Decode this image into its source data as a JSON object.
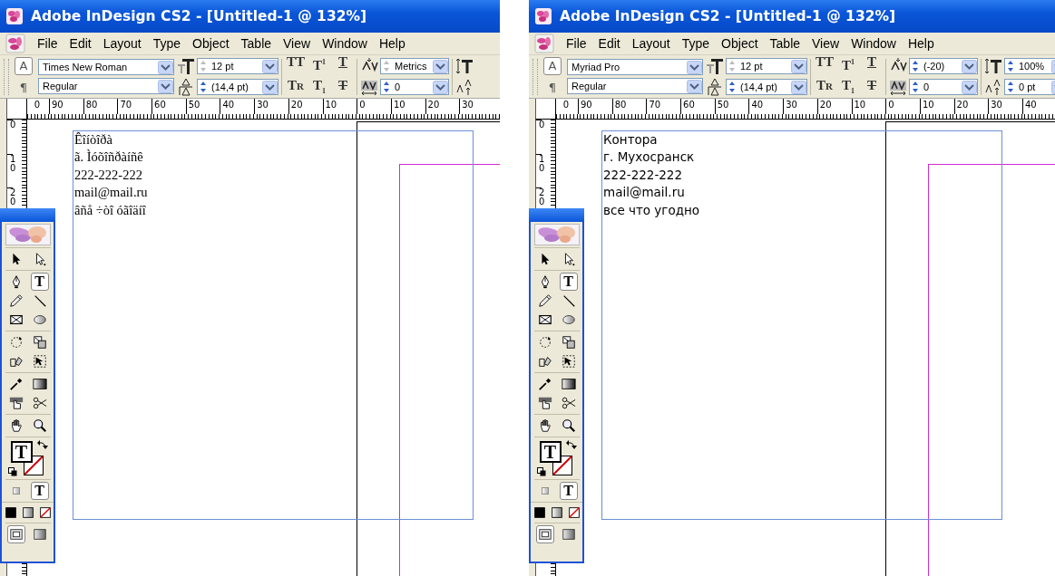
{
  "windows": [
    {
      "title": "Adobe InDesign CS2 - [Untitled-1 @ 132%]",
      "menu": [
        "File",
        "Edit",
        "Layout",
        "Type",
        "Object",
        "Table",
        "View",
        "Window",
        "Help"
      ],
      "control_bar": {
        "modes": [
          {
            "label": "A",
            "selected": true
          },
          {
            "label": "¶",
            "selected": false
          }
        ],
        "font": "Times New Roman",
        "style": "Regular",
        "size": {
          "value": "12 pt",
          "spinner_disabled": true
        },
        "leading": {
          "value": "(14,4 pt)",
          "spinner_disabled": false
        },
        "formats": [
          {
            "label": "TT",
            "kind": "all-caps"
          },
          {
            "label": "T$^{1}$",
            "kind": "superscript"
          },
          {
            "label": "T",
            "kind": "underline"
          },
          {
            "label": "Tr",
            "kind": "small-caps"
          },
          {
            "label": "T$_{1}$",
            "kind": "subscript"
          },
          {
            "label": "T",
            "kind": "strikethrough"
          }
        ],
        "kerning": {
          "value": "Metrics",
          "spinner_disabled": true
        },
        "tracking": {
          "value": "0",
          "spinner_disabled": false
        }
      },
      "ruler": {
        "horizontal": [
          "0",
          "90",
          "80",
          "70",
          "60",
          "50",
          "40",
          "30",
          "20",
          "10",
          "0",
          "10",
          "20",
          "30"
        ],
        "vertical": [
          "0",
          "10",
          "20"
        ]
      },
      "text_frame": {
        "kind": "serif",
        "lines": [
          "Êîíòîðà",
          "ã. Ìóõîñðàíñê",
          "222-222-222",
          "mail@mail.ru",
          "âñå ÷òî óãîäíî"
        ]
      },
      "toolbox": {
        "groups": [
          [
            {
              "kind": "selection",
              "selected": false
            },
            {
              "kind": "direct-selection",
              "selected": false
            }
          ],
          [
            {
              "kind": "pen",
              "selected": false
            },
            {
              "kind": "type",
              "label": "T",
              "selected": true
            },
            {
              "kind": "pencil",
              "selected": false
            },
            {
              "kind": "line",
              "selected": false
            },
            {
              "kind": "frame",
              "selected": false
            },
            {
              "kind": "ellipse",
              "selected": false
            }
          ],
          [
            {
              "kind": "rotate",
              "selected": false
            },
            {
              "kind": "scale",
              "selected": false
            },
            {
              "kind": "shear",
              "selected": false
            },
            {
              "kind": "free-transform",
              "selected": false
            }
          ],
          [
            {
              "kind": "eyedropper",
              "selected": false
            },
            {
              "kind": "gradient",
              "selected": false
            },
            {
              "kind": "button",
              "selected": false
            },
            {
              "kind": "scissors",
              "selected": false
            }
          ],
          [
            {
              "kind": "hand",
              "selected": false
            },
            {
              "kind": "zoom",
              "selected": false
            }
          ],
          [
            {
              "kind": "fill-stroke",
              "label": "T"
            }
          ],
          [
            {
              "kind": "format-container",
              "selected": false
            },
            {
              "kind": "format-text",
              "label": "T",
              "selected": true
            }
          ],
          [
            {
              "kind": "apply-color",
              "selected": false
            },
            {
              "kind": "apply-gradient",
              "selected": false
            },
            {
              "kind": "apply-none",
              "selected": false
            }
          ],
          [
            {
              "kind": "normal-view",
              "selected": true
            },
            {
              "kind": "preview",
              "selected": false
            }
          ]
        ]
      }
    },
    {
      "title": "Adobe InDesign CS2 - [Untitled-1 @ 132%]",
      "menu": [
        "File",
        "Edit",
        "Layout",
        "Type",
        "Object",
        "Table",
        "View",
        "Window",
        "Help"
      ],
      "control_bar": {
        "modes": [
          {
            "label": "A",
            "selected": true
          },
          {
            "label": "¶",
            "selected": false
          }
        ],
        "font": "Myriad Pro",
        "style": "Regular",
        "size": {
          "value": "12 pt",
          "spinner_disabled": true
        },
        "leading": {
          "value": "(14,4 pt)",
          "spinner_disabled": false
        },
        "formats": [
          {
            "label": "TT",
            "kind": "all-caps"
          },
          {
            "label": "T$^{1}$",
            "kind": "superscript"
          },
          {
            "label": "T",
            "kind": "underline"
          },
          {
            "label": "Tr",
            "kind": "small-caps"
          },
          {
            "label": "T$_{1}$",
            "kind": "subscript"
          },
          {
            "label": "T",
            "kind": "strikethrough"
          }
        ],
        "kerning": {
          "value": "(-20)",
          "spinner_disabled": false
        },
        "tracking": {
          "value": "0",
          "spinner_disabled": false
        },
        "vertical_scale": {
          "value": "100%",
          "spinner_disabled": false
        },
        "baseline_shift": {
          "value": "0 pt",
          "spinner_disabled": false
        }
      },
      "ruler": {
        "horizontal": [
          "0",
          "90",
          "80",
          "70",
          "60",
          "50",
          "40",
          "30",
          "20",
          "10",
          "0",
          "10",
          "20",
          "30",
          "40"
        ],
        "vertical": [
          "0",
          "10",
          "20"
        ]
      },
      "text_frame": {
        "kind": "sans",
        "lines": [
          "Контора",
          "г. Мухосранск",
          "222-222-222",
          "mail@mail.ru",
          "все что угодно"
        ]
      },
      "toolbox": {
        "groups": [
          [
            {
              "kind": "selection",
              "selected": false
            },
            {
              "kind": "direct-selection",
              "selected": false
            }
          ],
          [
            {
              "kind": "pen",
              "selected": false
            },
            {
              "kind": "type",
              "label": "T",
              "selected": true
            },
            {
              "kind": "pencil",
              "selected": false
            },
            {
              "kind": "line",
              "selected": false
            },
            {
              "kind": "frame",
              "selected": false
            },
            {
              "kind": "ellipse",
              "selected": false
            }
          ],
          [
            {
              "kind": "rotate",
              "selected": false
            },
            {
              "kind": "scale",
              "selected": false
            },
            {
              "kind": "shear",
              "selected": false
            },
            {
              "kind": "free-transform",
              "selected": false
            }
          ],
          [
            {
              "kind": "eyedropper",
              "selected": false
            },
            {
              "kind": "gradient",
              "selected": false
            },
            {
              "kind": "button",
              "selected": false
            },
            {
              "kind": "scissors",
              "selected": false
            }
          ],
          [
            {
              "kind": "hand",
              "selected": false
            },
            {
              "kind": "zoom",
              "selected": false
            }
          ],
          [
            {
              "kind": "fill-stroke",
              "label": "T"
            }
          ],
          [
            {
              "kind": "format-container",
              "selected": false
            },
            {
              "kind": "format-text",
              "label": "T",
              "selected": true
            }
          ],
          [
            {
              "kind": "apply-color",
              "selected": false
            },
            {
              "kind": "apply-gradient",
              "selected": false
            },
            {
              "kind": "apply-none",
              "selected": false
            }
          ],
          [
            {
              "kind": "normal-view",
              "selected": true
            },
            {
              "kind": "preview",
              "selected": false
            }
          ]
        ]
      }
    }
  ]
}
